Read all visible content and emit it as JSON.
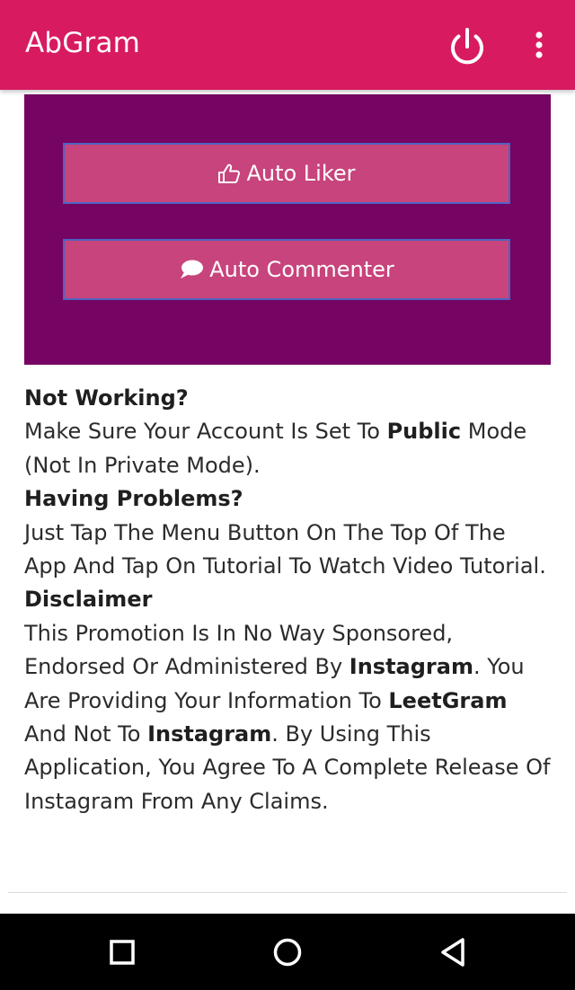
{
  "app": {
    "title": "AbGram",
    "accent_color": "#d81b60",
    "panel_color": "#760462",
    "button_color": "#c8447c",
    "icons": {
      "power": "power-icon",
      "menu": "more-vert-icon"
    }
  },
  "actions": {
    "auto_liker": {
      "label": "Auto Liker",
      "icon": "thumbs-up-icon"
    },
    "auto_commenter": {
      "label": "Auto Commenter",
      "icon": "comment-bubble-icon"
    }
  },
  "info": {
    "not_working": {
      "heading": "Not Working?",
      "text_before": "Make Sure Your Account Is Set To ",
      "bold": "Public",
      "text_after": " Mode (Not In Private Mode)."
    },
    "having_problems": {
      "heading": "Having Problems?",
      "text": "Just Tap The Menu Button On The Top Of The App And Tap On Tutorial To Watch Video Tutorial."
    },
    "disclaimer": {
      "heading": "Disclaimer",
      "t1": "This Promotion Is In No Way Sponsored, Endorsed Or Administered By ",
      "b1": "Instagram",
      "t2": ". You Are Providing Your Information To ",
      "b2": "LeetGram",
      "t3": " And Not To ",
      "b3": "Instagram",
      "t4": ". By Using This Application, You Agree To A Complete Release Of Instagram From Any Claims."
    }
  },
  "system_nav": {
    "recents": "square-recents-icon",
    "home": "circle-home-icon",
    "back": "triangle-back-icon"
  }
}
